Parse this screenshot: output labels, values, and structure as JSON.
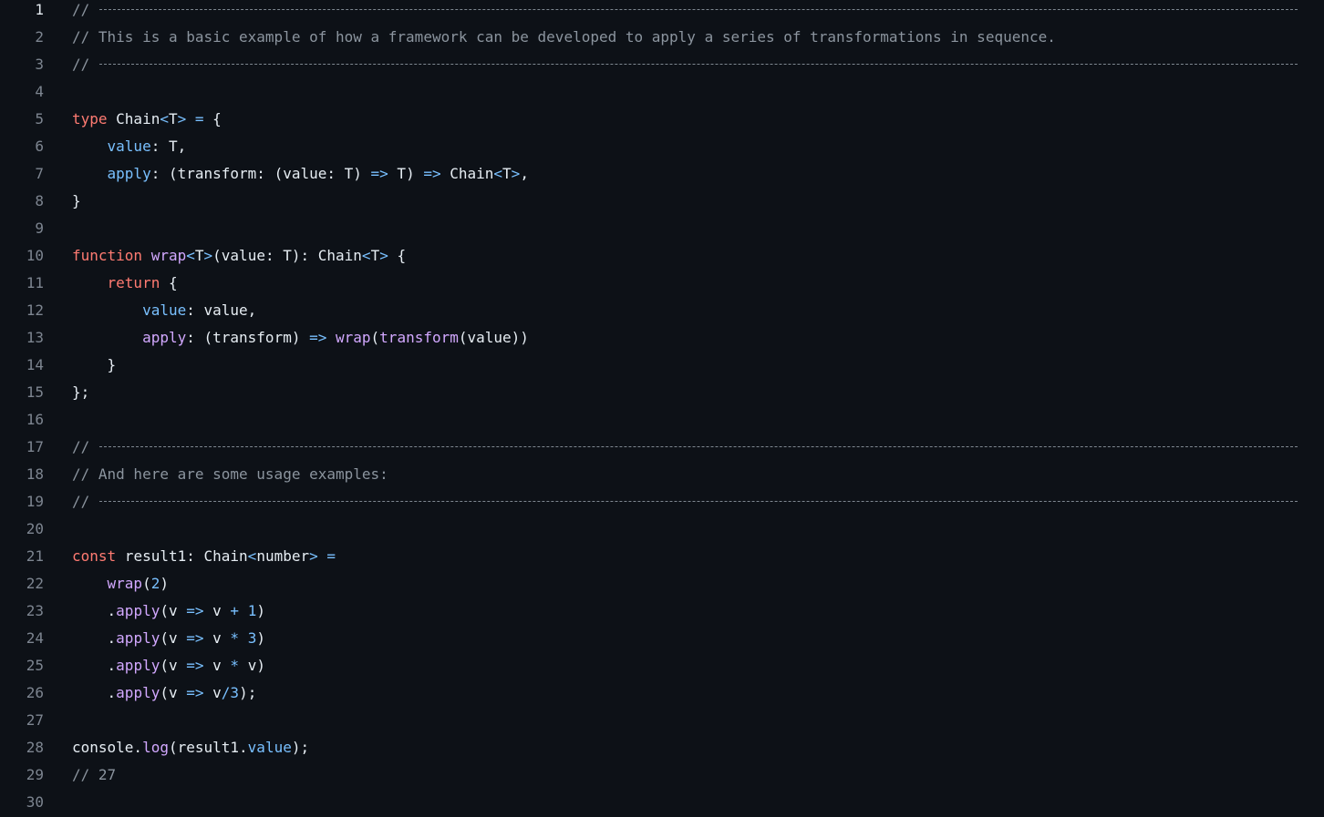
{
  "editor": {
    "lines": [
      {
        "n": "1",
        "tokens": [
          {
            "t": "// ",
            "c": "cm"
          }
        ],
        "rule": true
      },
      {
        "n": "2",
        "tokens": [
          {
            "t": "// This is a basic example of how a framework can be developed to apply a series of transformations in sequence.",
            "c": "cm"
          }
        ]
      },
      {
        "n": "3",
        "tokens": [
          {
            "t": "// ",
            "c": "cm"
          }
        ],
        "rule": true
      },
      {
        "n": "4",
        "tokens": []
      },
      {
        "n": "5",
        "tokens": [
          {
            "t": "type",
            "c": "kw"
          },
          {
            "t": " Chain",
            "c": "tx"
          },
          {
            "t": "<",
            "c": "op"
          },
          {
            "t": "T",
            "c": "tx"
          },
          {
            "t": ">",
            "c": "op"
          },
          {
            "t": " = ",
            "c": "op"
          },
          {
            "t": "{",
            "c": "tx"
          }
        ]
      },
      {
        "n": "6",
        "tokens": [
          {
            "t": "    ",
            "c": "tx"
          },
          {
            "t": "value",
            "c": "pr"
          },
          {
            "t": ": T,",
            "c": "tx"
          }
        ]
      },
      {
        "n": "7",
        "tokens": [
          {
            "t": "    ",
            "c": "tx"
          },
          {
            "t": "apply",
            "c": "pr"
          },
          {
            "t": ": (transform: (value: T) ",
            "c": "tx"
          },
          {
            "t": "=>",
            "c": "op"
          },
          {
            "t": " T) ",
            "c": "tx"
          },
          {
            "t": "=>",
            "c": "op"
          },
          {
            "t": " Chain",
            "c": "tx"
          },
          {
            "t": "<",
            "c": "op"
          },
          {
            "t": "T",
            "c": "tx"
          },
          {
            "t": ">",
            "c": "op"
          },
          {
            "t": ",",
            "c": "tx"
          }
        ]
      },
      {
        "n": "8",
        "tokens": [
          {
            "t": "}",
            "c": "tx"
          }
        ]
      },
      {
        "n": "9",
        "tokens": []
      },
      {
        "n": "10",
        "tokens": [
          {
            "t": "function",
            "c": "kw"
          },
          {
            "t": " ",
            "c": "tx"
          },
          {
            "t": "wrap",
            "c": "fn"
          },
          {
            "t": "<",
            "c": "op"
          },
          {
            "t": "T",
            "c": "tx"
          },
          {
            "t": ">",
            "c": "op"
          },
          {
            "t": "(value: T): Chain",
            "c": "tx"
          },
          {
            "t": "<",
            "c": "op"
          },
          {
            "t": "T",
            "c": "tx"
          },
          {
            "t": ">",
            "c": "op"
          },
          {
            "t": " {",
            "c": "tx"
          }
        ]
      },
      {
        "n": "11",
        "tokens": [
          {
            "t": "    ",
            "c": "tx"
          },
          {
            "t": "return",
            "c": "kw"
          },
          {
            "t": " {",
            "c": "tx"
          }
        ]
      },
      {
        "n": "12",
        "tokens": [
          {
            "t": "        ",
            "c": "tx"
          },
          {
            "t": "value",
            "c": "pr"
          },
          {
            "t": ": value,",
            "c": "tx"
          }
        ]
      },
      {
        "n": "13",
        "tokens": [
          {
            "t": "        ",
            "c": "tx"
          },
          {
            "t": "apply",
            "c": "fn"
          },
          {
            "t": ": (transform) ",
            "c": "tx"
          },
          {
            "t": "=>",
            "c": "op"
          },
          {
            "t": " ",
            "c": "tx"
          },
          {
            "t": "wrap",
            "c": "fn"
          },
          {
            "t": "(",
            "c": "tx"
          },
          {
            "t": "transform",
            "c": "fn"
          },
          {
            "t": "(value))",
            "c": "tx"
          }
        ]
      },
      {
        "n": "14",
        "tokens": [
          {
            "t": "    }",
            "c": "tx"
          }
        ]
      },
      {
        "n": "15",
        "tokens": [
          {
            "t": "};",
            "c": "tx"
          }
        ]
      },
      {
        "n": "16",
        "tokens": []
      },
      {
        "n": "17",
        "tokens": [
          {
            "t": "// ",
            "c": "cm"
          }
        ],
        "rule": true
      },
      {
        "n": "18",
        "tokens": [
          {
            "t": "// And here are some usage examples:",
            "c": "cm"
          }
        ]
      },
      {
        "n": "19",
        "tokens": [
          {
            "t": "// ",
            "c": "cm"
          }
        ],
        "rule": true
      },
      {
        "n": "20",
        "tokens": []
      },
      {
        "n": "21",
        "tokens": [
          {
            "t": "const",
            "c": "kw"
          },
          {
            "t": " result1: Chain",
            "c": "tx"
          },
          {
            "t": "<",
            "c": "op"
          },
          {
            "t": "number",
            "c": "tx"
          },
          {
            "t": ">",
            "c": "op"
          },
          {
            "t": " =",
            "c": "op"
          }
        ]
      },
      {
        "n": "22",
        "tokens": [
          {
            "t": "    ",
            "c": "tx"
          },
          {
            "t": "wrap",
            "c": "fn"
          },
          {
            "t": "(",
            "c": "tx"
          },
          {
            "t": "2",
            "c": "nm"
          },
          {
            "t": ")",
            "c": "tx"
          }
        ]
      },
      {
        "n": "23",
        "tokens": [
          {
            "t": "    .",
            "c": "tx"
          },
          {
            "t": "apply",
            "c": "fn"
          },
          {
            "t": "(v ",
            "c": "tx"
          },
          {
            "t": "=>",
            "c": "op"
          },
          {
            "t": " v ",
            "c": "tx"
          },
          {
            "t": "+",
            "c": "op"
          },
          {
            "t": " ",
            "c": "tx"
          },
          {
            "t": "1",
            "c": "nm"
          },
          {
            "t": ")",
            "c": "tx"
          }
        ]
      },
      {
        "n": "24",
        "tokens": [
          {
            "t": "    .",
            "c": "tx"
          },
          {
            "t": "apply",
            "c": "fn"
          },
          {
            "t": "(v ",
            "c": "tx"
          },
          {
            "t": "=>",
            "c": "op"
          },
          {
            "t": " v ",
            "c": "tx"
          },
          {
            "t": "*",
            "c": "op"
          },
          {
            "t": " ",
            "c": "tx"
          },
          {
            "t": "3",
            "c": "nm"
          },
          {
            "t": ")",
            "c": "tx"
          }
        ]
      },
      {
        "n": "25",
        "tokens": [
          {
            "t": "    .",
            "c": "tx"
          },
          {
            "t": "apply",
            "c": "fn"
          },
          {
            "t": "(v ",
            "c": "tx"
          },
          {
            "t": "=>",
            "c": "op"
          },
          {
            "t": " v ",
            "c": "tx"
          },
          {
            "t": "*",
            "c": "op"
          },
          {
            "t": " v)",
            "c": "tx"
          }
        ]
      },
      {
        "n": "26",
        "tokens": [
          {
            "t": "    .",
            "c": "tx"
          },
          {
            "t": "apply",
            "c": "fn"
          },
          {
            "t": "(v ",
            "c": "tx"
          },
          {
            "t": "=>",
            "c": "op"
          },
          {
            "t": " v",
            "c": "tx"
          },
          {
            "t": "/",
            "c": "op"
          },
          {
            "t": "3",
            "c": "nm"
          },
          {
            "t": ");",
            "c": "tx"
          }
        ]
      },
      {
        "n": "27",
        "tokens": []
      },
      {
        "n": "28",
        "tokens": [
          {
            "t": "console.",
            "c": "tx"
          },
          {
            "t": "log",
            "c": "fn"
          },
          {
            "t": "(result1.",
            "c": "tx"
          },
          {
            "t": "value",
            "c": "pr"
          },
          {
            "t": ");",
            "c": "tx"
          }
        ]
      },
      {
        "n": "29",
        "tokens": [
          {
            "t": "// 27",
            "c": "cm"
          }
        ]
      },
      {
        "n": "30",
        "tokens": []
      }
    ]
  },
  "colors": {
    "background": "#0d1117",
    "comment": "#8b949e",
    "keyword": "#ff7b72",
    "function": "#d2a8ff",
    "property": "#79c0ff",
    "text": "#e6edf3",
    "line_number": "#7d8590"
  }
}
